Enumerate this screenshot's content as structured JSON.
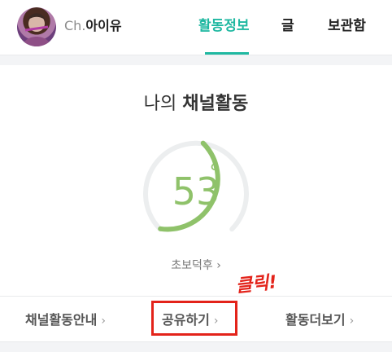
{
  "header": {
    "channel_prefix": "Ch.",
    "channel_title": "아이유",
    "tabs": [
      {
        "label": "활동정보"
      },
      {
        "label": "글"
      },
      {
        "label": "보관함"
      }
    ]
  },
  "activity": {
    "title_prefix": "나의",
    "title_main": "채널활동",
    "gauge_value": "53",
    "gauge_unit": "°",
    "gauge_level": 0.53,
    "level_label": "초보덕후",
    "level_chevron": "›"
  },
  "links": {
    "guide": "채널활동안내",
    "share": "공유하기",
    "more": "활동더보기",
    "chevron": "›"
  },
  "annotation": {
    "label": "클릭!"
  },
  "colors": {
    "accent": "#1fb8a1",
    "gauge": "#8fc26a",
    "highlight": "#e3231a"
  }
}
